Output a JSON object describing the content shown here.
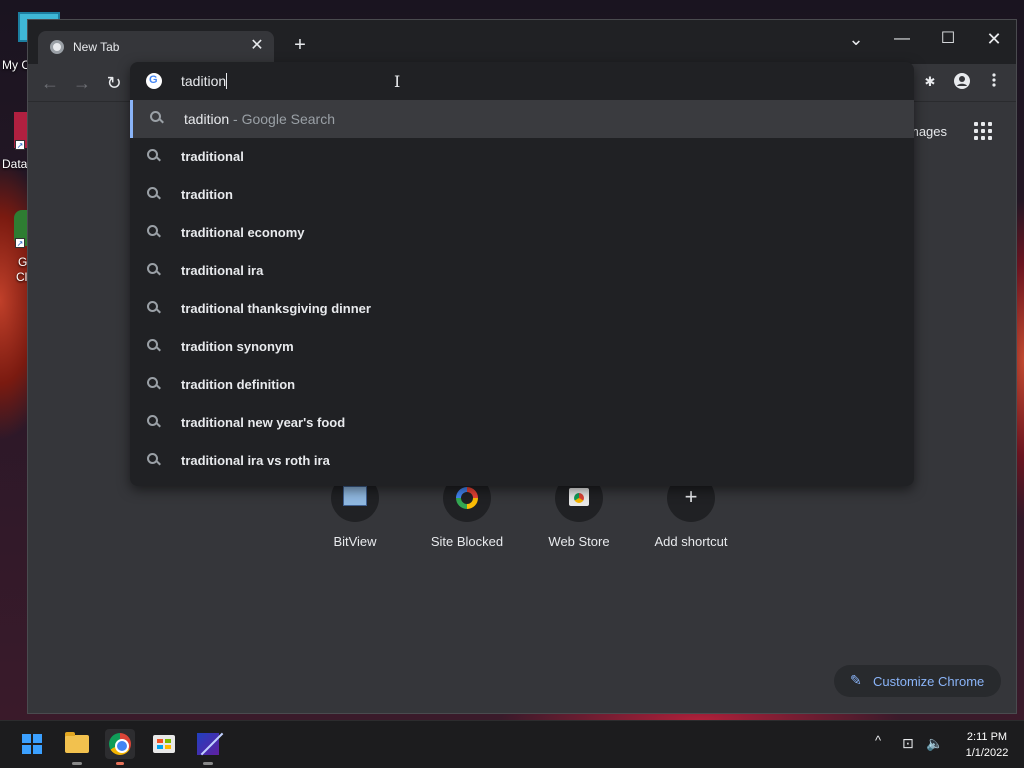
{
  "desktop": {
    "icons": [
      {
        "label": "My C"
      },
      {
        "label": "Data"
      },
      {
        "label": "G"
      },
      {
        "label": "Cl"
      }
    ]
  },
  "browser": {
    "tab": {
      "title": "New Tab",
      "close_glyph": "✕"
    },
    "new_tab_glyph": "+",
    "window_controls": {
      "list": "⌄",
      "minimize": "—",
      "maximize": "☐",
      "close": "✕"
    },
    "nav": {
      "back": "←",
      "forward": "→",
      "reload": "↻"
    },
    "toolbar_icons": [
      "extensions-icon",
      "profile-icon",
      "menu-icon"
    ]
  },
  "omnibox": {
    "input_value": "tadition",
    "suggestions": [
      {
        "text": "tadition",
        "desc": " - Google Search",
        "selected": true
      },
      {
        "text": "traditional"
      },
      {
        "text": "tradition"
      },
      {
        "text": "traditional economy"
      },
      {
        "text": "traditional ira"
      },
      {
        "text": "traditional thanksgiving dinner"
      },
      {
        "text": "tradition synonym"
      },
      {
        "text": "tradition definition"
      },
      {
        "text": "traditional new year's food"
      },
      {
        "text": "traditional ira vs roth ira"
      }
    ]
  },
  "ntp": {
    "images_link": "mages",
    "shortcuts": [
      {
        "label": "BitView"
      },
      {
        "label": "Site Blocked"
      },
      {
        "label": "Web Store"
      },
      {
        "label": "Add shortcut",
        "glyph": "+"
      }
    ],
    "customize_label": "Customize Chrome"
  },
  "taskbar": {
    "tray": {
      "chevron": "^",
      "network": "⊡",
      "volume": "🔈"
    },
    "clock": {
      "time": "2:11 PM",
      "date": "1/1/2022"
    }
  },
  "colors": {
    "accent": "#8ab4f8",
    "panel": "#202124",
    "page": "#35363a"
  }
}
